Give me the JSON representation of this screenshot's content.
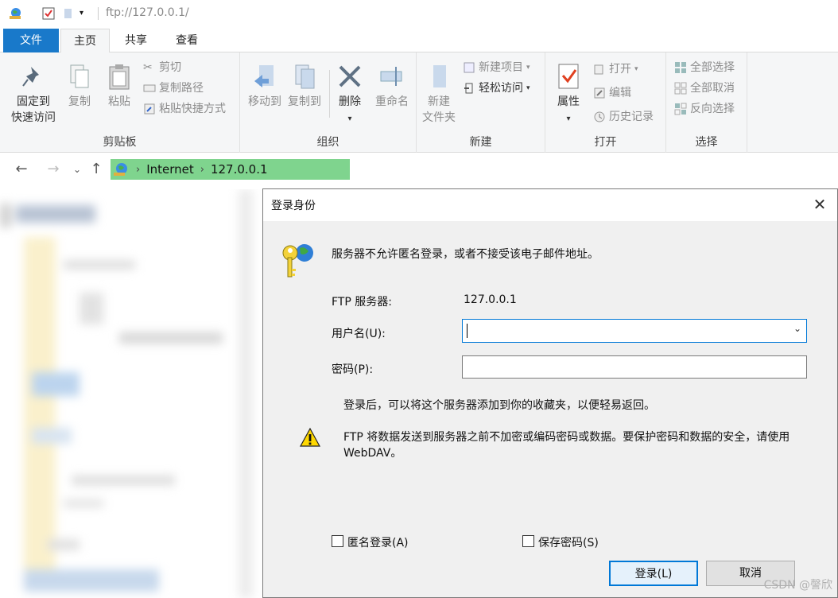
{
  "titlebar": {
    "path": "ftp://127.0.0.1/"
  },
  "ribbon_tabs": {
    "file": "文件",
    "home": "主页",
    "share": "共享",
    "view": "查看"
  },
  "clipboard": {
    "pin_line1": "固定到",
    "pin_line2": "快速访问",
    "copy": "复制",
    "paste": "粘贴",
    "cut": "剪切",
    "copy_path": "复制路径",
    "paste_shortcut": "粘贴快捷方式",
    "group_label": "剪贴板"
  },
  "organize": {
    "move_to": "移动到",
    "copy_to": "复制到",
    "delete": "删除",
    "rename": "重命名",
    "group_label": "组织"
  },
  "new_group": {
    "new_folder_line1": "新建",
    "new_folder_line2": "文件夹",
    "new_item": "新建项目",
    "easy_access": "轻松访问",
    "group_label": "新建"
  },
  "open_group": {
    "properties": "属性",
    "open": "打开",
    "edit": "编辑",
    "history": "历史记录",
    "group_label": "打开"
  },
  "select_group": {
    "select_all": "全部选择",
    "select_none": "全部取消",
    "invert": "反向选择",
    "group_label": "选择"
  },
  "address": {
    "crumb1": "Internet",
    "crumb2": "127.0.0.1"
  },
  "dialog": {
    "title": "登录身份",
    "message": "服务器不允许匿名登录，或者不接受该电子邮件地址。",
    "server_label": "FTP 服务器:",
    "server_value": "127.0.0.1",
    "username_label": "用户名(U):",
    "username_value": "",
    "password_label": "密码(P):",
    "password_value": "",
    "info_text": "登录后，可以将这个服务器添加到你的收藏夹，以便轻易返回。",
    "warning_line1": "FTP 将数据发送到服务器之前不加密或编码密码或数据。要保护密码和数据的安全，请使用",
    "warning_line2": "WebDAV。",
    "anonymous_label": "匿名登录(A)",
    "save_password_label": "保存密码(S)",
    "login_button": "登录(L)",
    "cancel_button": "取消",
    "watermark": "CSDN @謦欣"
  }
}
